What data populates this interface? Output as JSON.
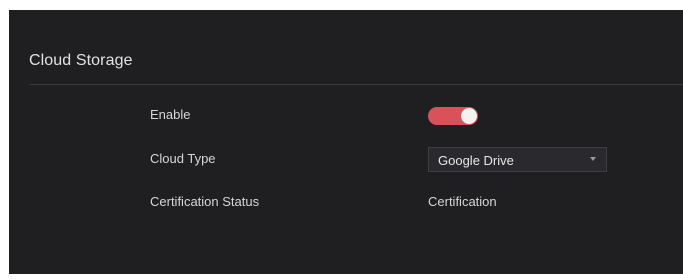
{
  "section": {
    "title": "Cloud Storage"
  },
  "fields": {
    "enable": {
      "label": "Enable",
      "state": "on",
      "color_on": "#d9525a"
    },
    "cloud_type": {
      "label": "Cloud Type",
      "value": "Google Drive",
      "icon": "chevron-down-icon"
    },
    "certification_status": {
      "label": "Certification Status",
      "value": "Certification"
    }
  }
}
